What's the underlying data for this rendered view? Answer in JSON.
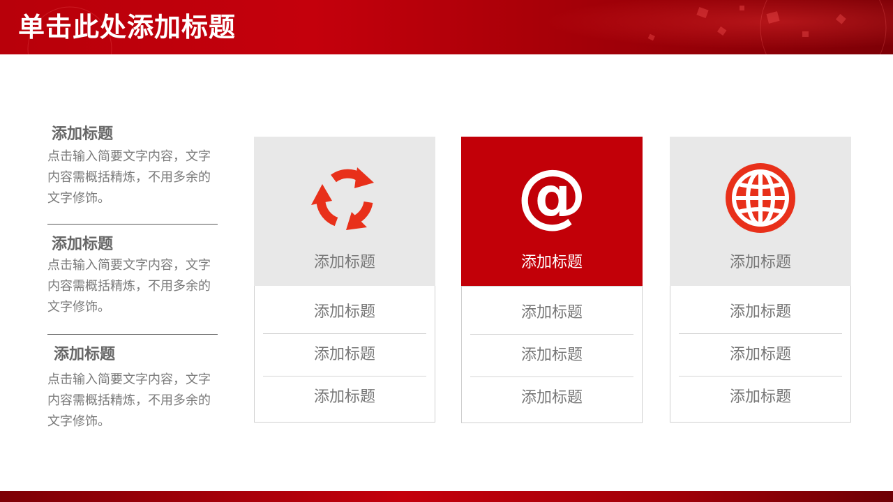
{
  "header": {
    "title": "单击此处添加标题"
  },
  "left_items": [
    {
      "title": "添加标题",
      "desc": "点击输入简要文字内容，文字内容需概括精炼，不用多余的文字修饰。"
    },
    {
      "title": "添加标题",
      "desc": "点击输入简要文字内容，文字内容需概括精炼，不用多余的文字修饰。"
    },
    {
      "title": "添加标题",
      "desc": "点击输入简要文字内容，文字内容需概括精炼，不用多余的文字修饰。"
    }
  ],
  "cards": [
    {
      "icon": "recycle-icon",
      "title": "添加标题",
      "rows": [
        "添加标题",
        "添加标题",
        "添加标题"
      ]
    },
    {
      "icon": "at-sign-icon",
      "title": "添加标题",
      "rows": [
        "添加标题",
        "添加标题",
        "添加标题"
      ],
      "active": true
    },
    {
      "icon": "globe-icon",
      "title": "添加标题",
      "rows": [
        "添加标题",
        "添加标题",
        "添加标题"
      ]
    }
  ],
  "colors": {
    "accent": "#c20008",
    "icon_red": "#e8301a",
    "card_bg": "#e8e8e8",
    "text_gray": "#777777"
  }
}
